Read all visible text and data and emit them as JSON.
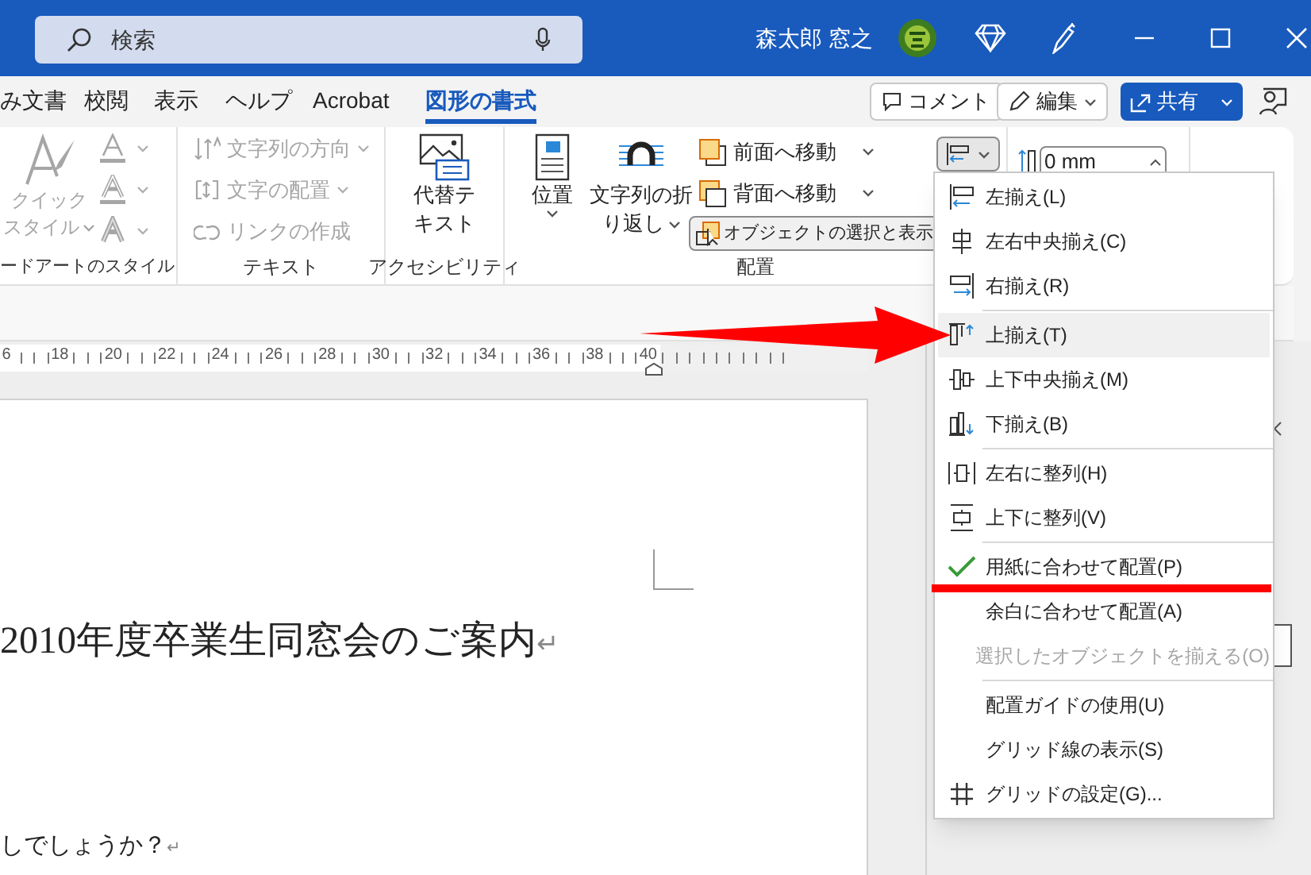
{
  "title_bar": {
    "search_placeholder": "検索",
    "user_name": "森太郎 窓之"
  },
  "menu_tabs": [
    {
      "label": "み文書",
      "selected": false
    },
    {
      "label": "校閲",
      "selected": false
    },
    {
      "label": "表示",
      "selected": false
    },
    {
      "label": "ヘルプ",
      "selected": false
    },
    {
      "label": "Acrobat",
      "selected": false
    },
    {
      "label": "図形の書式",
      "selected": true
    }
  ],
  "actions": [
    {
      "kind": "comment",
      "label": "コメント"
    },
    {
      "kind": "edit",
      "label": "編集"
    },
    {
      "kind": "share",
      "label": "共有"
    }
  ],
  "ribbon": {
    "wordart": {
      "quick_style": [
        "クイック",
        "スタイル"
      ],
      "disabled": true,
      "group_label": "ードアートのスタイル"
    },
    "text": {
      "items": [
        {
          "label": "文字列の方向",
          "dropdown": true
        },
        {
          "label": "文字の配置",
          "dropdown": true
        },
        {
          "label": "リンクの作成",
          "dropdown": false
        }
      ],
      "disabled": true,
      "group_label": "テキスト"
    },
    "accessibility": {
      "alt_text": [
        "代替テ",
        "キスト"
      ],
      "group_label": "アクセシビリティ"
    },
    "arrange": {
      "position": "位置",
      "wrap": [
        "文字列の折",
        "り返し"
      ],
      "bring_forward": "前面へ移動",
      "send_backward": "背面へ移動",
      "selection_pane": "オブジェクトの選択と表示",
      "group_label": "配置",
      "align_open": true
    },
    "size": {
      "value": "0 mm"
    }
  },
  "ruler": {
    "labels": [
      "6",
      "18",
      "20",
      "22",
      "24",
      "26",
      "28",
      "30",
      "32",
      "34",
      "36",
      "38",
      "40"
    ]
  },
  "document": {
    "lines": [
      {
        "text": "2010年度卒業生同窓会のご案内",
        "mark": "↵",
        "kind": "heading"
      },
      {
        "text": "しでしょうか？",
        "mark": "↵",
        "kind": "body"
      }
    ]
  },
  "align_menu": {
    "items": [
      {
        "kind": "item",
        "label": "左揃え(L)",
        "highlighted": false,
        "checked": false,
        "disabled": false
      },
      {
        "kind": "item",
        "label": "左右中央揃え(C)",
        "highlighted": false,
        "checked": false,
        "disabled": false
      },
      {
        "kind": "item",
        "label": "右揃え(R)",
        "highlighted": false,
        "checked": false,
        "disabled": false
      },
      {
        "kind": "separator"
      },
      {
        "kind": "item",
        "label": "上揃え(T)",
        "highlighted": true,
        "checked": false,
        "disabled": false
      },
      {
        "kind": "item",
        "label": "上下中央揃え(M)",
        "highlighted": false,
        "checked": false,
        "disabled": false
      },
      {
        "kind": "item",
        "label": "下揃え(B)",
        "highlighted": false,
        "checked": false,
        "disabled": false
      },
      {
        "kind": "separator"
      },
      {
        "kind": "item",
        "label": "左右に整列(H)",
        "highlighted": false,
        "checked": false,
        "disabled": false
      },
      {
        "kind": "item",
        "label": "上下に整列(V)",
        "highlighted": false,
        "checked": false,
        "disabled": false
      },
      {
        "kind": "separator"
      },
      {
        "kind": "item",
        "label": "用紙に合わせて配置(P)",
        "highlighted": false,
        "checked": true,
        "disabled": false
      },
      {
        "kind": "item",
        "label": "余白に合わせて配置(A)",
        "highlighted": false,
        "checked": false,
        "disabled": false
      },
      {
        "kind": "item",
        "label": "選択したオブジェクトを揃える(O)",
        "highlighted": false,
        "checked": false,
        "disabled": true
      },
      {
        "kind": "separator"
      },
      {
        "kind": "item",
        "label": "配置ガイドの使用(U)",
        "highlighted": false,
        "checked": false,
        "disabled": false
      },
      {
        "kind": "item",
        "label": "グリッド線の表示(S)",
        "highlighted": false,
        "checked": false,
        "disabled": false
      },
      {
        "kind": "item",
        "label": "グリッドの設定(G)...",
        "highlighted": false,
        "checked": false,
        "disabled": false
      }
    ]
  },
  "annotations": [
    {
      "kind": "arrow"
    },
    {
      "kind": "underline"
    }
  ]
}
